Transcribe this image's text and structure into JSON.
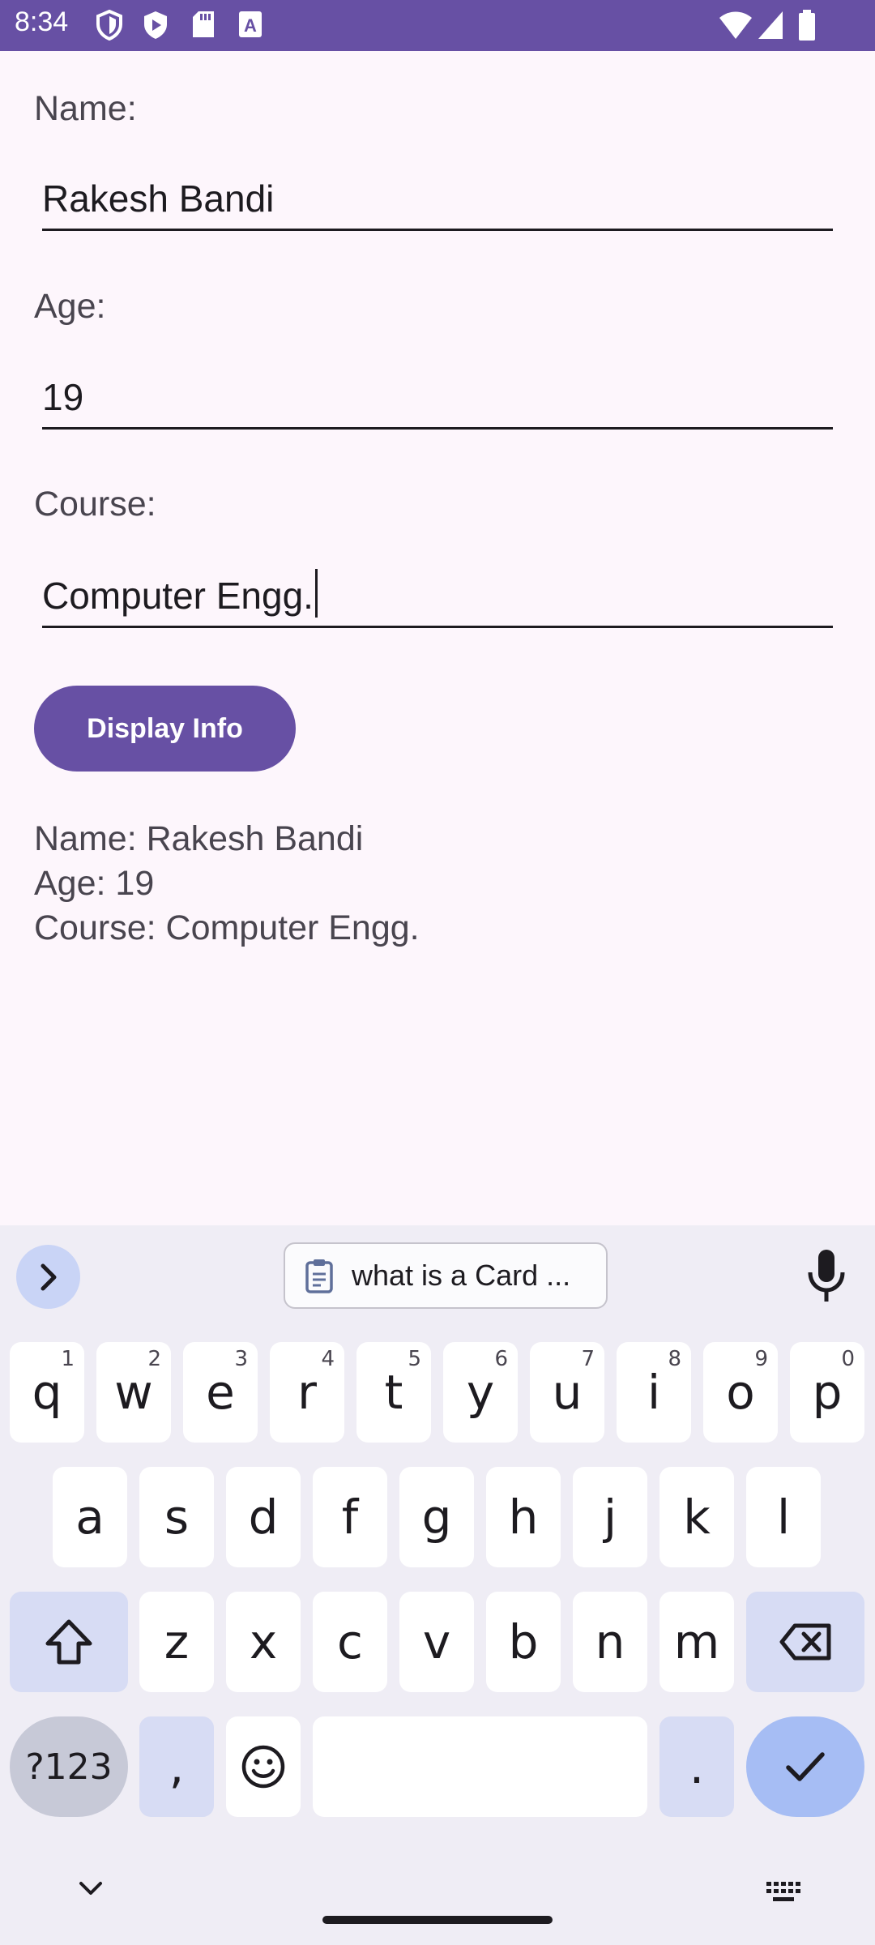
{
  "status_bar": {
    "time": "8:34",
    "left_icons": [
      "shield-icon",
      "play-shield-icon",
      "sd-card-icon",
      "font-icon"
    ],
    "right_icons": [
      "wifi-icon",
      "signal-icon",
      "battery-icon"
    ],
    "background": "#6750a4"
  },
  "form": {
    "name_label": "Name:",
    "name_value": "Rakesh Bandi",
    "age_label": "Age:",
    "age_value": "19",
    "course_label": "Course:",
    "course_value": "Computer Engg."
  },
  "button": {
    "display_label": "Display Info",
    "color": "#6750a4"
  },
  "output": {
    "name_line": "Name: Rakesh Bandi",
    "age_line": "Age: 19",
    "course_line": "Course: Computer Engg."
  },
  "keyboard": {
    "suggestion_chip": "what is a Card ...",
    "row1": [
      {
        "key": "q",
        "sup": "1"
      },
      {
        "key": "w",
        "sup": "2"
      },
      {
        "key": "e",
        "sup": "3"
      },
      {
        "key": "r",
        "sup": "4"
      },
      {
        "key": "t",
        "sup": "5"
      },
      {
        "key": "y",
        "sup": "6"
      },
      {
        "key": "u",
        "sup": "7"
      },
      {
        "key": "i",
        "sup": "8"
      },
      {
        "key": "o",
        "sup": "9"
      },
      {
        "key": "p",
        "sup": "0"
      }
    ],
    "row2": [
      "a",
      "s",
      "d",
      "f",
      "g",
      "h",
      "j",
      "k",
      "l"
    ],
    "row3": [
      "z",
      "x",
      "c",
      "v",
      "b",
      "n",
      "m"
    ],
    "symbols_label": "?123",
    "comma_label": ",",
    "period_label": "."
  }
}
